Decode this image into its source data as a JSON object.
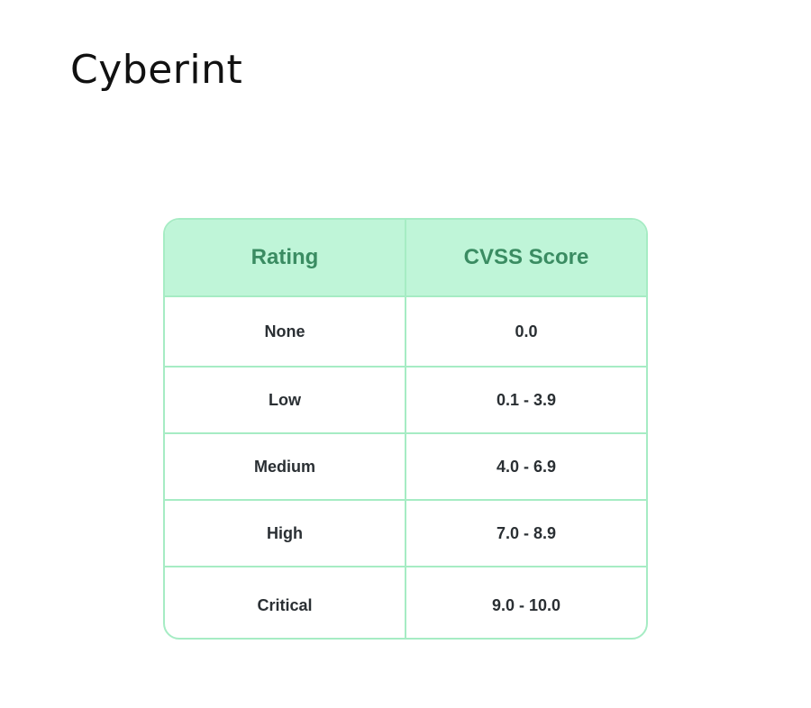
{
  "logo": {
    "text": "Cyberint"
  },
  "table": {
    "headers": {
      "rating": "Rating",
      "score": "CVSS Score"
    },
    "rows": [
      {
        "rating": "None",
        "score": "0.0"
      },
      {
        "rating": "Low",
        "score": "0.1 - 3.9"
      },
      {
        "rating": "Medium",
        "score": "4.0 - 6.9"
      },
      {
        "rating": "High",
        "score": "7.0 - 8.9"
      },
      {
        "rating": "Critical",
        "score": "9.0 - 10.0"
      }
    ]
  },
  "colors": {
    "header_bg": "#bff5d8",
    "header_text": "#3a8c62",
    "border": "#a6ecc4",
    "cell_text": "#2a2f33"
  }
}
